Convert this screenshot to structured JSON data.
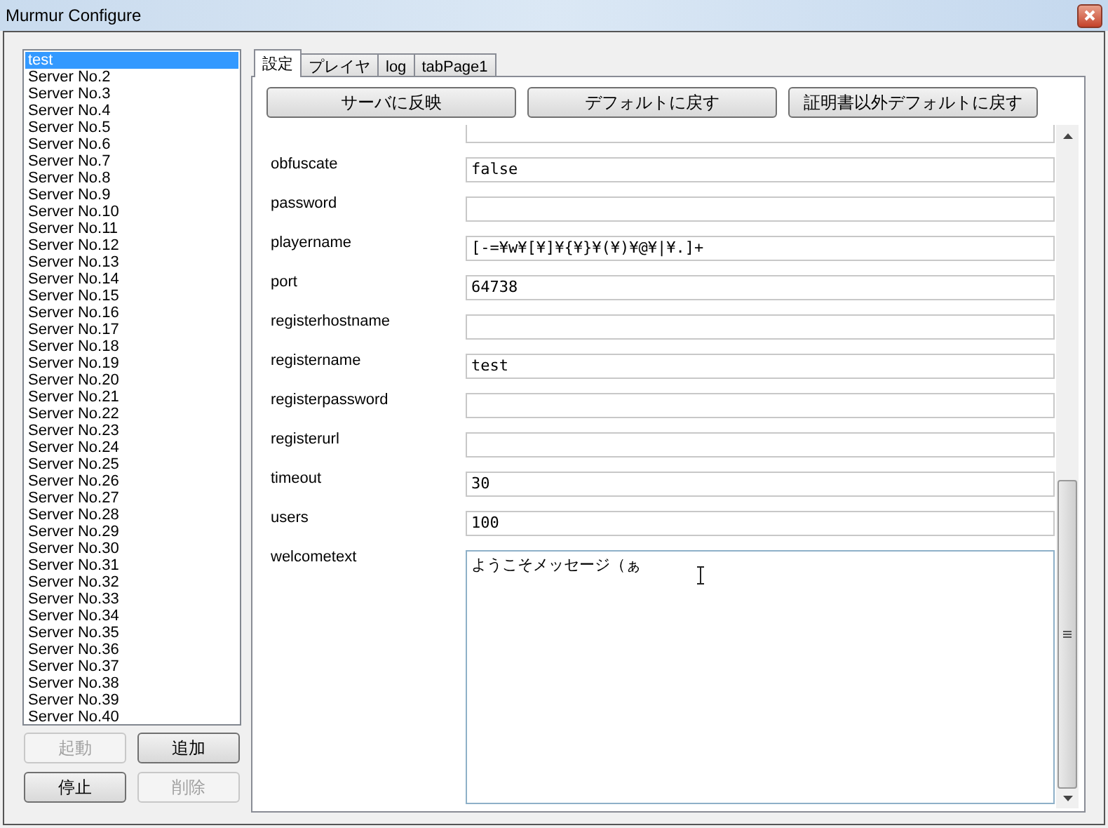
{
  "window": {
    "title": "Murmur Configure"
  },
  "servers": [
    {
      "label": "test",
      "selected": true
    },
    {
      "label": "Server No.2",
      "selected": false
    },
    {
      "label": "Server No.3",
      "selected": false
    },
    {
      "label": "Server No.4",
      "selected": false
    },
    {
      "label": "Server No.5",
      "selected": false
    },
    {
      "label": "Server No.6",
      "selected": false
    },
    {
      "label": "Server No.7",
      "selected": false
    },
    {
      "label": "Server No.8",
      "selected": false
    },
    {
      "label": "Server No.9",
      "selected": false
    },
    {
      "label": "Server No.10",
      "selected": false
    },
    {
      "label": "Server No.11",
      "selected": false
    },
    {
      "label": "Server No.12",
      "selected": false
    },
    {
      "label": "Server No.13",
      "selected": false
    },
    {
      "label": "Server No.14",
      "selected": false
    },
    {
      "label": "Server No.15",
      "selected": false
    },
    {
      "label": "Server No.16",
      "selected": false
    },
    {
      "label": "Server No.17",
      "selected": false
    },
    {
      "label": "Server No.18",
      "selected": false
    },
    {
      "label": "Server No.19",
      "selected": false
    },
    {
      "label": "Server No.20",
      "selected": false
    },
    {
      "label": "Server No.21",
      "selected": false
    },
    {
      "label": "Server No.22",
      "selected": false
    },
    {
      "label": "Server No.23",
      "selected": false
    },
    {
      "label": "Server No.24",
      "selected": false
    },
    {
      "label": "Server No.25",
      "selected": false
    },
    {
      "label": "Server No.26",
      "selected": false
    },
    {
      "label": "Server No.27",
      "selected": false
    },
    {
      "label": "Server No.28",
      "selected": false
    },
    {
      "label": "Server No.29",
      "selected": false
    },
    {
      "label": "Server No.30",
      "selected": false
    },
    {
      "label": "Server No.31",
      "selected": false
    },
    {
      "label": "Server No.32",
      "selected": false
    },
    {
      "label": "Server No.33",
      "selected": false
    },
    {
      "label": "Server No.34",
      "selected": false
    },
    {
      "label": "Server No.35",
      "selected": false
    },
    {
      "label": "Server No.36",
      "selected": false
    },
    {
      "label": "Server No.37",
      "selected": false
    },
    {
      "label": "Server No.38",
      "selected": false
    },
    {
      "label": "Server No.39",
      "selected": false
    },
    {
      "label": "Server No.40",
      "selected": false
    }
  ],
  "server_buttons": [
    {
      "label": "起動",
      "disabled": true
    },
    {
      "label": "追加",
      "disabled": false
    },
    {
      "label": "停止",
      "disabled": false
    },
    {
      "label": "削除",
      "disabled": true
    }
  ],
  "tabs": [
    {
      "label": "設定",
      "selected": true
    },
    {
      "label": "プレイヤ",
      "selected": false
    },
    {
      "label": "log",
      "selected": false
    },
    {
      "label": "tabPage1",
      "selected": false
    }
  ],
  "actions": [
    "サーバに反映",
    "デフォルトに戻す",
    "証明書以外デフォルトに戻す"
  ],
  "settings": [
    {
      "name": "obfuscate",
      "value": "false"
    },
    {
      "name": "password"
    },
    {
      "name": "playername",
      "value": "[-=¥w¥[¥]¥{¥}¥(¥)¥@¥|¥.]+"
    },
    {
      "name": "port",
      "value": "64738"
    },
    {
      "name": "registerhostname"
    },
    {
      "name": "registername",
      "value": "test"
    },
    {
      "name": "registerpassword"
    },
    {
      "name": "registerurl"
    },
    {
      "name": "timeout",
      "value": "30"
    },
    {
      "name": "users",
      "value": "100"
    },
    {
      "name": "welcometext",
      "value": "ようこそメッセージ（ぁ",
      "kind": "multiline"
    }
  ]
}
